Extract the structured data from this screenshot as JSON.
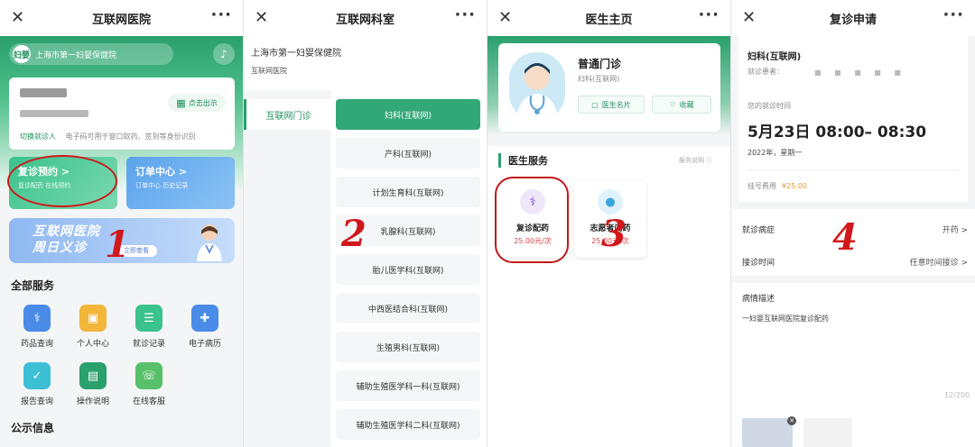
{
  "panel1": {
    "title": "互联网医院",
    "hospital_name": "上海市第一妇婴保健院",
    "logo_text": "妇婴",
    "qr_button": "点击出示",
    "switch_label": "切换就诊人",
    "switch_note": "电子码可用于窗口取药、签到等身份识别",
    "tile1_title": "复诊预约 >",
    "tile1_sub": "复诊配药 在线预约",
    "tile2_title": "订单中心 >",
    "tile2_sub": "订单中心 历史记录",
    "banner_line1": "互联网医院",
    "banner_line2": "周日义诊",
    "banner_button": "立即查看",
    "step": "1",
    "section_all": "全部服务",
    "services": [
      {
        "label": "药品查询",
        "icon": "pill-search-icon",
        "color": "#4a8be8",
        "glyph": "⚕"
      },
      {
        "label": "个人中心",
        "icon": "id-card-icon",
        "color": "#f2b63a",
        "glyph": "▣"
      },
      {
        "label": "就诊记录",
        "icon": "record-icon",
        "color": "#3cc28c",
        "glyph": "☰"
      },
      {
        "label": "电子病历",
        "icon": "medical-record-icon",
        "color": "#4a8be8",
        "glyph": "✚"
      },
      {
        "label": "报告查询",
        "icon": "report-icon",
        "color": "#3dbfd6",
        "glyph": "✓"
      },
      {
        "label": "操作说明",
        "icon": "manual-icon",
        "color": "#2aa06d",
        "glyph": "▤"
      },
      {
        "label": "在线客服",
        "icon": "headset-icon",
        "color": "#57c06a",
        "glyph": "☏"
      }
    ],
    "section_notice": "公示信息"
  },
  "panel2": {
    "title": "互联网科室",
    "hospital_name": "上海市第一妇婴保健院",
    "subtitle": "互联网医院",
    "left_tab": "互联网门诊",
    "step": "2",
    "departments": [
      "妇科(互联网)",
      "产科(互联网)",
      "计划生育科(互联网)",
      "乳腺科(互联网)",
      "胎儿医学科(互联网)",
      "中西医结合科(互联网)",
      "生殖男科(互联网)",
      "辅助生殖医学科一科(互联网)",
      "辅助生殖医学科二科(互联网)"
    ]
  },
  "panel3": {
    "title": "医生主页",
    "doctor_name": "普通门诊",
    "doctor_dept": "妇科(互联网)",
    "btn_card": "医生名片",
    "btn_fav": "收藏",
    "section_title": "医生服务",
    "section_note": "服务说明 ⓘ",
    "step": "3",
    "services": [
      {
        "name": "复诊配药",
        "price": "25.00元/次"
      },
      {
        "name": "志愿者问药",
        "price": "25.00元/次"
      }
    ]
  },
  "panel4": {
    "title": "复诊申请",
    "dept": "妇科(互联网)",
    "patient_label": "就诊患者：",
    "patient_mask": "■ ■ ■ ■ ■",
    "time_label": "您的就诊时间",
    "time_value": "5月23日 08:00– 08:30",
    "date_value": "2022年，星期一",
    "fee_label": "挂号费用",
    "fee_value": "¥25.00",
    "step": "4",
    "row1_label": "就诊病症",
    "row1_value": "开药 >",
    "row2_label": "接诊时间",
    "row2_value": "任意时间接诊 >",
    "desc_label": "病情描述",
    "desc_value": "一妇婴互联网医院复诊配药",
    "counter": "12/200"
  },
  "common": {
    "close_glyph": "✕",
    "more_glyph": "···"
  }
}
